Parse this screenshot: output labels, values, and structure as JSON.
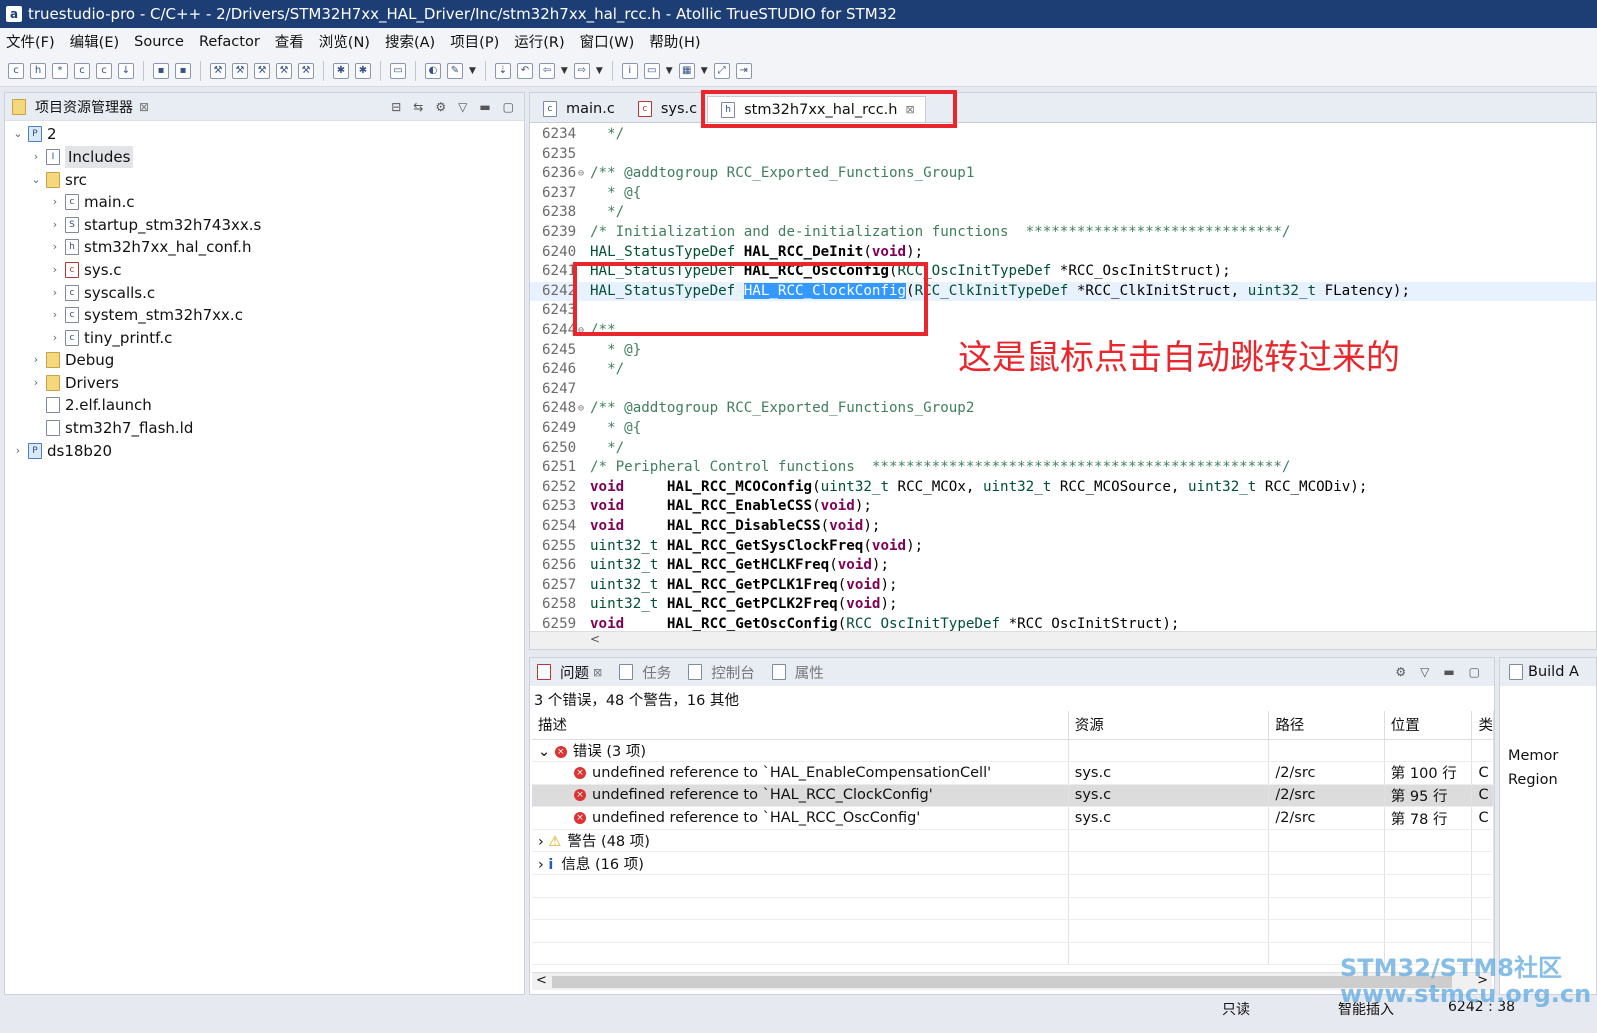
{
  "window": {
    "title": "truestudio-pro - C/C++ - 2/Drivers/STM32H7xx_HAL_Driver/Inc/stm32h7xx_hal_rcc.h - Atollic TrueSTUDIO for STM32"
  },
  "menu": [
    "文件(F)",
    "编辑(E)",
    "Source",
    "Refactor",
    "查看",
    "浏览(N)",
    "搜索(A)",
    "项目(P)",
    "运行(R)",
    "窗口(W)",
    "帮助(H)"
  ],
  "explorer": {
    "title": "项目资源管理器",
    "close": "⊠",
    "tree": [
      {
        "label": "2",
        "toggle": "⌄",
        "icon": "P"
      },
      {
        "label": "Includes",
        "toggle": "›",
        "icon": "I"
      },
      {
        "label": "src",
        "toggle": "⌄",
        "icon": "📁"
      },
      {
        "label": "main.c",
        "toggle": "›",
        "icon": "c"
      },
      {
        "label": "startup_stm32h743xx.s",
        "toggle": "›",
        "icon": "S"
      },
      {
        "label": "stm32h7xx_hal_conf.h",
        "toggle": "›",
        "icon": "h"
      },
      {
        "label": "sys.c",
        "toggle": "›",
        "icon": "c"
      },
      {
        "label": "syscalls.c",
        "toggle": "›",
        "icon": "c"
      },
      {
        "label": "system_stm32h7xx.c",
        "toggle": "›",
        "icon": "c"
      },
      {
        "label": "tiny_printf.c",
        "toggle": "›",
        "icon": "c"
      },
      {
        "label": "Debug",
        "toggle": "›",
        "icon": ""
      },
      {
        "label": "Drivers",
        "toggle": "›",
        "icon": ""
      },
      {
        "label": "2.elf.launch",
        "toggle": "",
        "icon": ""
      },
      {
        "label": "stm32h7_flash.ld",
        "toggle": "",
        "icon": ""
      },
      {
        "label": "ds18b20",
        "toggle": "›",
        "icon": "P"
      }
    ]
  },
  "editor": {
    "tabs": [
      {
        "label": "main.c",
        "icon": "c"
      },
      {
        "label": "sys.c",
        "icon": "c"
      },
      {
        "label": "stm32h7xx_hal_rcc.h",
        "icon": "h",
        "close": "⊠"
      }
    ],
    "lines": [
      {
        "n": "6234",
        "segs": [
          [
            "cm",
            "  */"
          ]
        ]
      },
      {
        "n": "6235",
        "segs": []
      },
      {
        "n": "6236",
        "fold": "⊖",
        "segs": [
          [
            "cm",
            "/** @addtogroup RCC_Exported_Functions_Group1"
          ]
        ]
      },
      {
        "n": "6237",
        "segs": [
          [
            "cm",
            "  * @{"
          ]
        ]
      },
      {
        "n": "6238",
        "segs": [
          [
            "cm",
            "  */"
          ]
        ]
      },
      {
        "n": "6239",
        "segs": [
          [
            "cm",
            "/* Initialization and de-initialization functions  ******************************/"
          ]
        ]
      },
      {
        "n": "6240",
        "segs": [
          [
            "ty",
            "HAL_StatusTypeDef "
          ],
          [
            "fn",
            "HAL_RCC_DeInit"
          ],
          [
            "pl",
            "("
          ],
          [
            "kw",
            "void"
          ],
          [
            "pl",
            ");"
          ]
        ]
      },
      {
        "n": "6241",
        "segs": [
          [
            "ty",
            "HAL_StatusTypeDef "
          ],
          [
            "fn",
            "HAL_RCC_OscConfig"
          ],
          [
            "pl",
            "("
          ],
          [
            "ty",
            "RCC_OscInitTypeDef"
          ],
          [
            "pl",
            " *RCC_OscInitStruct);"
          ]
        ]
      },
      {
        "n": "6242",
        "hl": true,
        "segs": [
          [
            "ty",
            "HAL_StatusTypeDef "
          ],
          [
            "sel",
            "HAL_RCC_ClockConfig"
          ],
          [
            "pl",
            "("
          ],
          [
            "ty",
            "RCC_ClkInitTypeDef"
          ],
          [
            "pl",
            " *RCC_ClkInitStruct, "
          ],
          [
            "ty",
            "uint32_t"
          ],
          [
            "pl",
            " FLatency);"
          ]
        ]
      },
      {
        "n": "6243",
        "segs": []
      },
      {
        "n": "6244",
        "fold": "⊖",
        "segs": [
          [
            "cm",
            "/**"
          ]
        ]
      },
      {
        "n": "6245",
        "segs": [
          [
            "cm",
            "  * @}"
          ]
        ]
      },
      {
        "n": "6246",
        "segs": [
          [
            "cm",
            "  */"
          ]
        ]
      },
      {
        "n": "6247",
        "segs": []
      },
      {
        "n": "6248",
        "fold": "⊖",
        "segs": [
          [
            "cm",
            "/** @addtogroup RCC_Exported_Functions_Group2"
          ]
        ]
      },
      {
        "n": "6249",
        "segs": [
          [
            "cm",
            "  * @{"
          ]
        ]
      },
      {
        "n": "6250",
        "segs": [
          [
            "cm",
            "  */"
          ]
        ]
      },
      {
        "n": "6251",
        "segs": [
          [
            "cm",
            "/* Peripheral Control functions  ************************************************/"
          ]
        ]
      },
      {
        "n": "6252",
        "segs": [
          [
            "kw",
            "void"
          ],
          [
            "pl",
            "     "
          ],
          [
            "fn",
            "HAL_RCC_MCOConfig"
          ],
          [
            "pl",
            "("
          ],
          [
            "ty",
            "uint32_t"
          ],
          [
            "pl",
            " RCC_MCOx, "
          ],
          [
            "ty",
            "uint32_t"
          ],
          [
            "pl",
            " RCC_MCOSource, "
          ],
          [
            "ty",
            "uint32_t"
          ],
          [
            "pl",
            " RCC_MCODiv);"
          ]
        ]
      },
      {
        "n": "6253",
        "segs": [
          [
            "kw",
            "void"
          ],
          [
            "pl",
            "     "
          ],
          [
            "fn",
            "HAL_RCC_EnableCSS"
          ],
          [
            "pl",
            "("
          ],
          [
            "kw",
            "void"
          ],
          [
            "pl",
            ");"
          ]
        ]
      },
      {
        "n": "6254",
        "segs": [
          [
            "kw",
            "void"
          ],
          [
            "pl",
            "     "
          ],
          [
            "fn",
            "HAL_RCC_DisableCSS"
          ],
          [
            "pl",
            "("
          ],
          [
            "kw",
            "void"
          ],
          [
            "pl",
            ");"
          ]
        ]
      },
      {
        "n": "6255",
        "segs": [
          [
            "ty",
            "uint32_t"
          ],
          [
            "pl",
            " "
          ],
          [
            "fn",
            "HAL_RCC_GetSysClockFreq"
          ],
          [
            "pl",
            "("
          ],
          [
            "kw",
            "void"
          ],
          [
            "pl",
            ");"
          ]
        ]
      },
      {
        "n": "6256",
        "segs": [
          [
            "ty",
            "uint32_t"
          ],
          [
            "pl",
            " "
          ],
          [
            "fn",
            "HAL_RCC_GetHCLKFreq"
          ],
          [
            "pl",
            "("
          ],
          [
            "kw",
            "void"
          ],
          [
            "pl",
            ");"
          ]
        ]
      },
      {
        "n": "6257",
        "segs": [
          [
            "ty",
            "uint32_t"
          ],
          [
            "pl",
            " "
          ],
          [
            "fn",
            "HAL_RCC_GetPCLK1Freq"
          ],
          [
            "pl",
            "("
          ],
          [
            "kw",
            "void"
          ],
          [
            "pl",
            ");"
          ]
        ]
      },
      {
        "n": "6258",
        "segs": [
          [
            "ty",
            "uint32_t"
          ],
          [
            "pl",
            " "
          ],
          [
            "fn",
            "HAL_RCC_GetPCLK2Freq"
          ],
          [
            "pl",
            "("
          ],
          [
            "kw",
            "void"
          ],
          [
            "pl",
            ");"
          ]
        ]
      },
      {
        "n": "6259",
        "segs": [
          [
            "kw",
            "void"
          ],
          [
            "pl",
            "     "
          ],
          [
            "fn",
            "HAL_RCC_GetOscConfig"
          ],
          [
            "pl",
            "("
          ],
          [
            "ty",
            "RCC_OscInitTypeDef"
          ],
          [
            "pl",
            " *RCC_OscInitStruct);"
          ]
        ]
      }
    ]
  },
  "problems": {
    "tabs": [
      {
        "label": "问题",
        "active": true,
        "close": "⊠"
      },
      {
        "label": "任务",
        "active": false
      },
      {
        "label": "控制台",
        "active": false
      },
      {
        "label": "属性",
        "active": false
      }
    ],
    "summary": "3 个错误，48 个警告，16 其他",
    "columns": [
      "描述",
      "资源",
      "路径",
      "位置",
      "类"
    ],
    "groups": {
      "errors": {
        "toggle": "⌄",
        "label": "错误",
        "count": "(3 项)"
      },
      "warnings": {
        "toggle": "›",
        "label": "警告",
        "count": "(48 项)"
      },
      "info": {
        "toggle": "›",
        "label": "信息",
        "count": "(16 项)"
      }
    },
    "rows": [
      {
        "desc": "undefined reference to `HAL_EnableCompensationCell'",
        "resource": "sys.c",
        "path": "/2/src",
        "location": "第 100 行",
        "type": "C"
      },
      {
        "desc": "undefined reference to `HAL_RCC_ClockConfig'",
        "resource": "sys.c",
        "path": "/2/src",
        "location": "第 95 行",
        "type": "C"
      },
      {
        "desc": "undefined reference to `HAL_RCC_OscConfig'",
        "resource": "sys.c",
        "path": "/2/src",
        "location": "第 78 行",
        "type": "C"
      }
    ],
    "scroll_left": "<",
    "scroll_right": ">"
  },
  "build": {
    "title": "Build A",
    "cells": [
      "Memor",
      "Region"
    ]
  },
  "status": {
    "mode": "只读",
    "insert": "智能插入",
    "position": "6242 : 38"
  },
  "annotation": "这是鼠标点击自动跳转过来的",
  "watermark": {
    "line1": "STM32/STM8社区",
    "line2": "www.stmcu.org.cn"
  }
}
